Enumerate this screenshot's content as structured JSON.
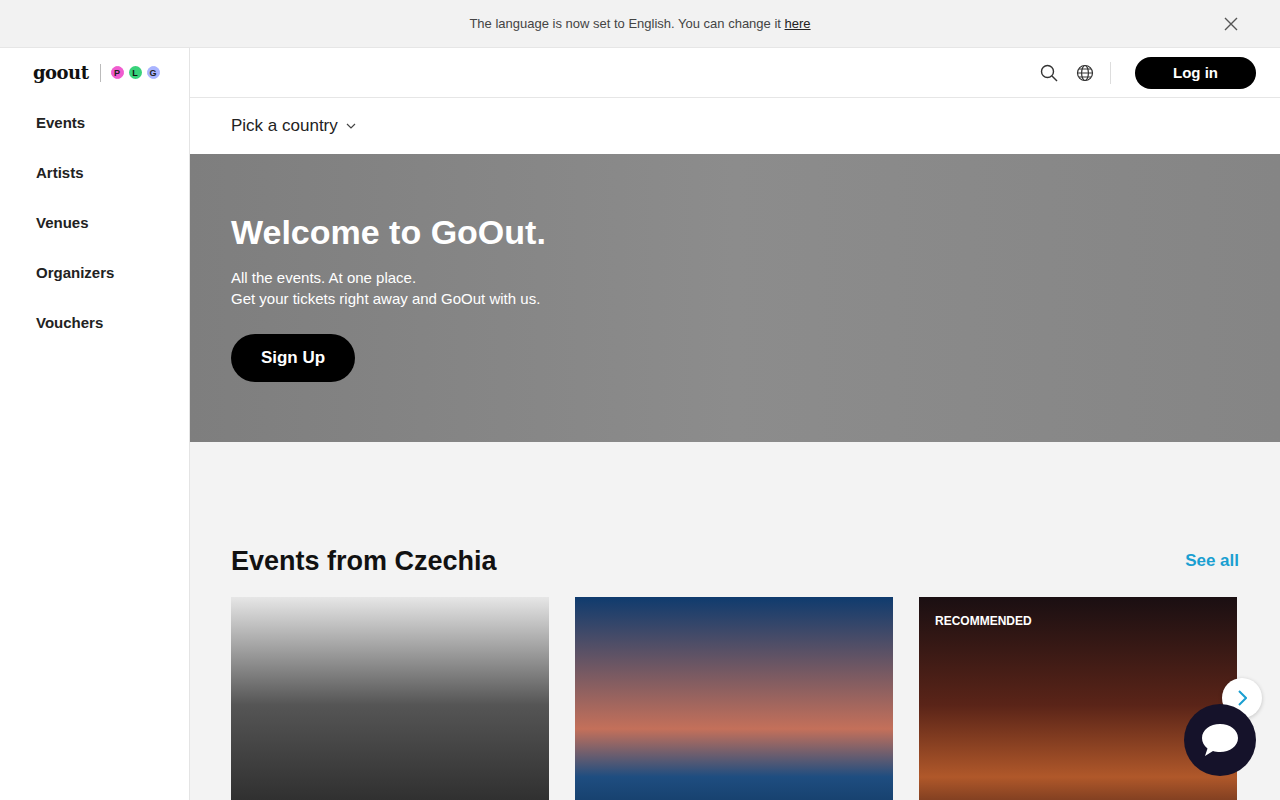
{
  "banner": {
    "text": "The language is now set to English. You can change it ",
    "link": "here"
  },
  "logo": {
    "text": "goout",
    "badges": [
      {
        "letter": "P",
        "color": "#f05ccf"
      },
      {
        "letter": "L",
        "color": "#38d27a"
      },
      {
        "letter": "G",
        "color": "#a9b4ff"
      }
    ]
  },
  "sidebar": {
    "items": [
      {
        "label": "Events"
      },
      {
        "label": "Artists"
      },
      {
        "label": "Venues"
      },
      {
        "label": "Organizers"
      },
      {
        "label": "Vouchers"
      }
    ]
  },
  "header": {
    "login": "Log in"
  },
  "country": {
    "label": "Pick a country"
  },
  "hero": {
    "title": "Welcome to GoOut.",
    "lines": [
      "All the events. At one place.",
      "Get your tickets right away and GoOut with us."
    ],
    "button": "Sign Up"
  },
  "section": {
    "title": "Events from Czechia",
    "link": "See all",
    "badge_label": "RECOMMENDED",
    "cards": [
      {
        "recommended": false
      },
      {
        "recommended": false
      },
      {
        "recommended": true
      }
    ]
  }
}
